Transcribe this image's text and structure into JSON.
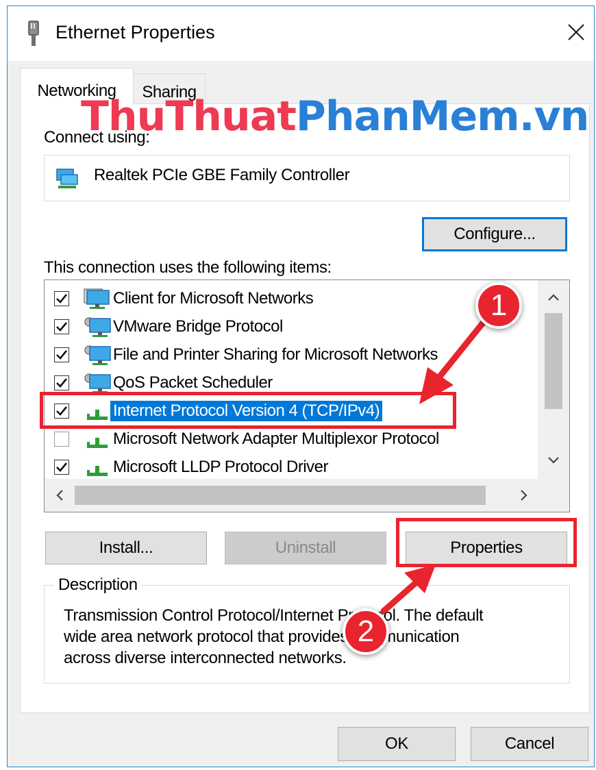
{
  "window": {
    "title": "Ethernet Properties",
    "close_glyph": "✕",
    "accent_color": "#0078d7"
  },
  "tabs": [
    {
      "label": "Networking",
      "active": true
    },
    {
      "label": "Sharing",
      "active": false
    }
  ],
  "watermark": {
    "part1": "ThuThuat",
    "part2": "PhanMem.vn"
  },
  "connect_using": {
    "label": "Connect using:",
    "adapter_name": "Realtek PCIe GBE Family Controller",
    "adapter_icon": "network-adapter-icon"
  },
  "configure_label": "Configure...",
  "items_heading": "This connection uses the following items:",
  "items": [
    {
      "label": "Client for Microsoft Networks",
      "checked": true,
      "selected": false,
      "icon": "network-client-icon"
    },
    {
      "label": "VMware Bridge Protocol",
      "checked": true,
      "selected": false,
      "icon": "network-service-icon"
    },
    {
      "label": "File and Printer Sharing for Microsoft Networks",
      "checked": true,
      "selected": false,
      "icon": "network-service-icon"
    },
    {
      "label": "QoS Packet Scheduler",
      "checked": true,
      "selected": false,
      "icon": "network-service-icon"
    },
    {
      "label": "Internet Protocol Version 4 (TCP/IPv4)",
      "checked": true,
      "selected": true,
      "icon": "network-protocol-icon"
    },
    {
      "label": "Microsoft Network Adapter Multiplexor Protocol",
      "checked": false,
      "selected": false,
      "icon": "network-protocol-icon"
    },
    {
      "label": "Microsoft LLDP Protocol Driver",
      "checked": true,
      "selected": false,
      "icon": "network-protocol-icon"
    }
  ],
  "buttons": {
    "install": "Install...",
    "uninstall": "Uninstall",
    "properties": "Properties",
    "ok": "OK",
    "cancel": "Cancel"
  },
  "description": {
    "legend": "Description",
    "line1": "Transmission Control Protocol/Internet Protocol. The default",
    "line2": "wide area network protocol that provides communication",
    "line3": "across diverse interconnected networks."
  },
  "annotations": {
    "step1": "1",
    "step2": "2",
    "highlight_color": "#e8242f"
  }
}
